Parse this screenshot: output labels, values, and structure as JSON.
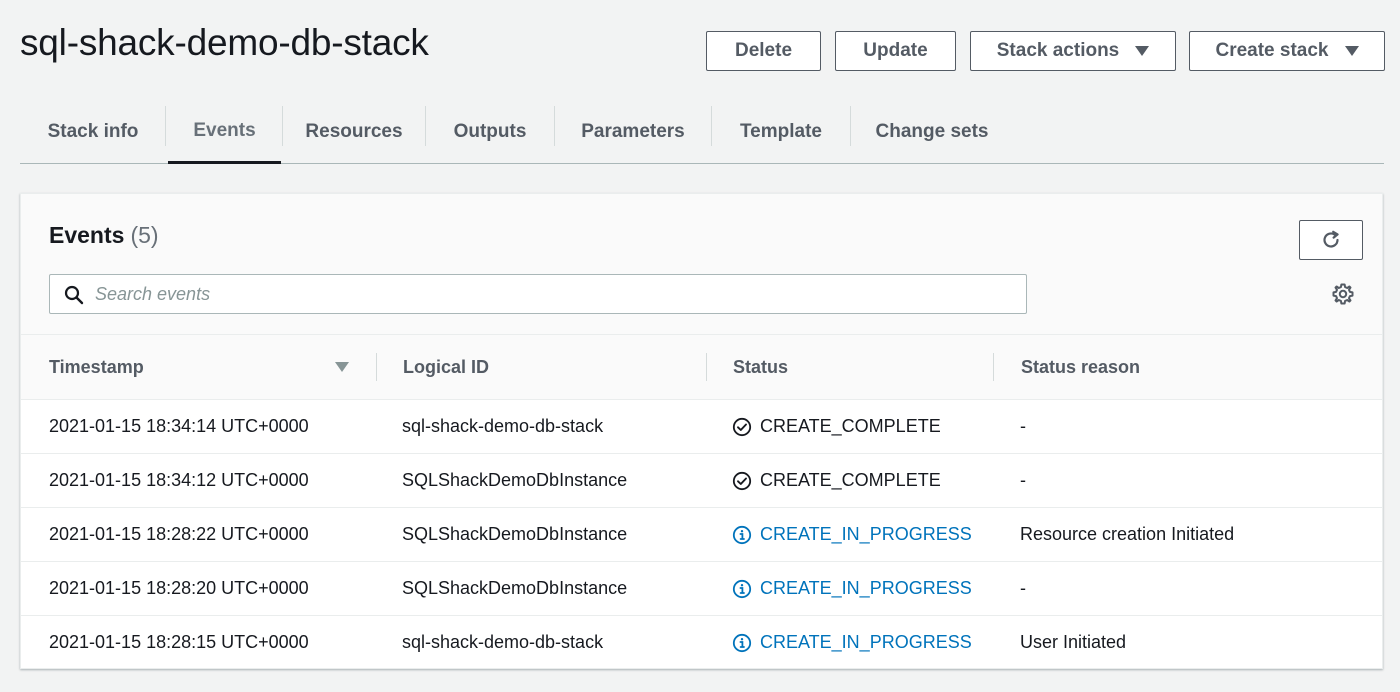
{
  "page": {
    "title": "sql-shack-demo-db-stack"
  },
  "actions": {
    "delete": "Delete",
    "update": "Update",
    "stack_actions": "Stack actions",
    "create_stack": "Create stack"
  },
  "tabs": [
    {
      "label": "Stack info"
    },
    {
      "label": "Events",
      "active": true
    },
    {
      "label": "Resources"
    },
    {
      "label": "Outputs"
    },
    {
      "label": "Parameters"
    },
    {
      "label": "Template"
    },
    {
      "label": "Change sets"
    }
  ],
  "events": {
    "heading": "Events",
    "count": "(5)",
    "search_placeholder": "Search events",
    "columns": {
      "timestamp": "Timestamp",
      "logical_id": "Logical ID",
      "status": "Status",
      "status_reason": "Status reason"
    },
    "rows": [
      {
        "timestamp": "2021-01-15 18:34:14 UTC+0000",
        "logical_id": "sql-shack-demo-db-stack",
        "status": "CREATE_COMPLETE",
        "status_icon": "check-circle-icon",
        "reason": "-"
      },
      {
        "timestamp": "2021-01-15 18:34:12 UTC+0000",
        "logical_id": "SQLShackDemoDbInstance",
        "status": "CREATE_COMPLETE",
        "status_icon": "check-circle-icon",
        "reason": "-"
      },
      {
        "timestamp": "2021-01-15 18:28:22 UTC+0000",
        "logical_id": "SQLShackDemoDbInstance",
        "status": "CREATE_IN_PROGRESS",
        "status_icon": "info-circle-icon",
        "reason": "Resource creation Initiated"
      },
      {
        "timestamp": "2021-01-15 18:28:20 UTC+0000",
        "logical_id": "SQLShackDemoDbInstance",
        "status": "CREATE_IN_PROGRESS",
        "status_icon": "info-circle-icon",
        "reason": "-"
      },
      {
        "timestamp": "2021-01-15 18:28:15 UTC+0000",
        "logical_id": "sql-shack-demo-db-stack",
        "status": "CREATE_IN_PROGRESS",
        "status_icon": "info-circle-icon",
        "reason": "User Initiated"
      }
    ]
  },
  "colors": {
    "in_progress": "#0073bb",
    "complete": "#16191f",
    "button_border": "#545b64"
  }
}
